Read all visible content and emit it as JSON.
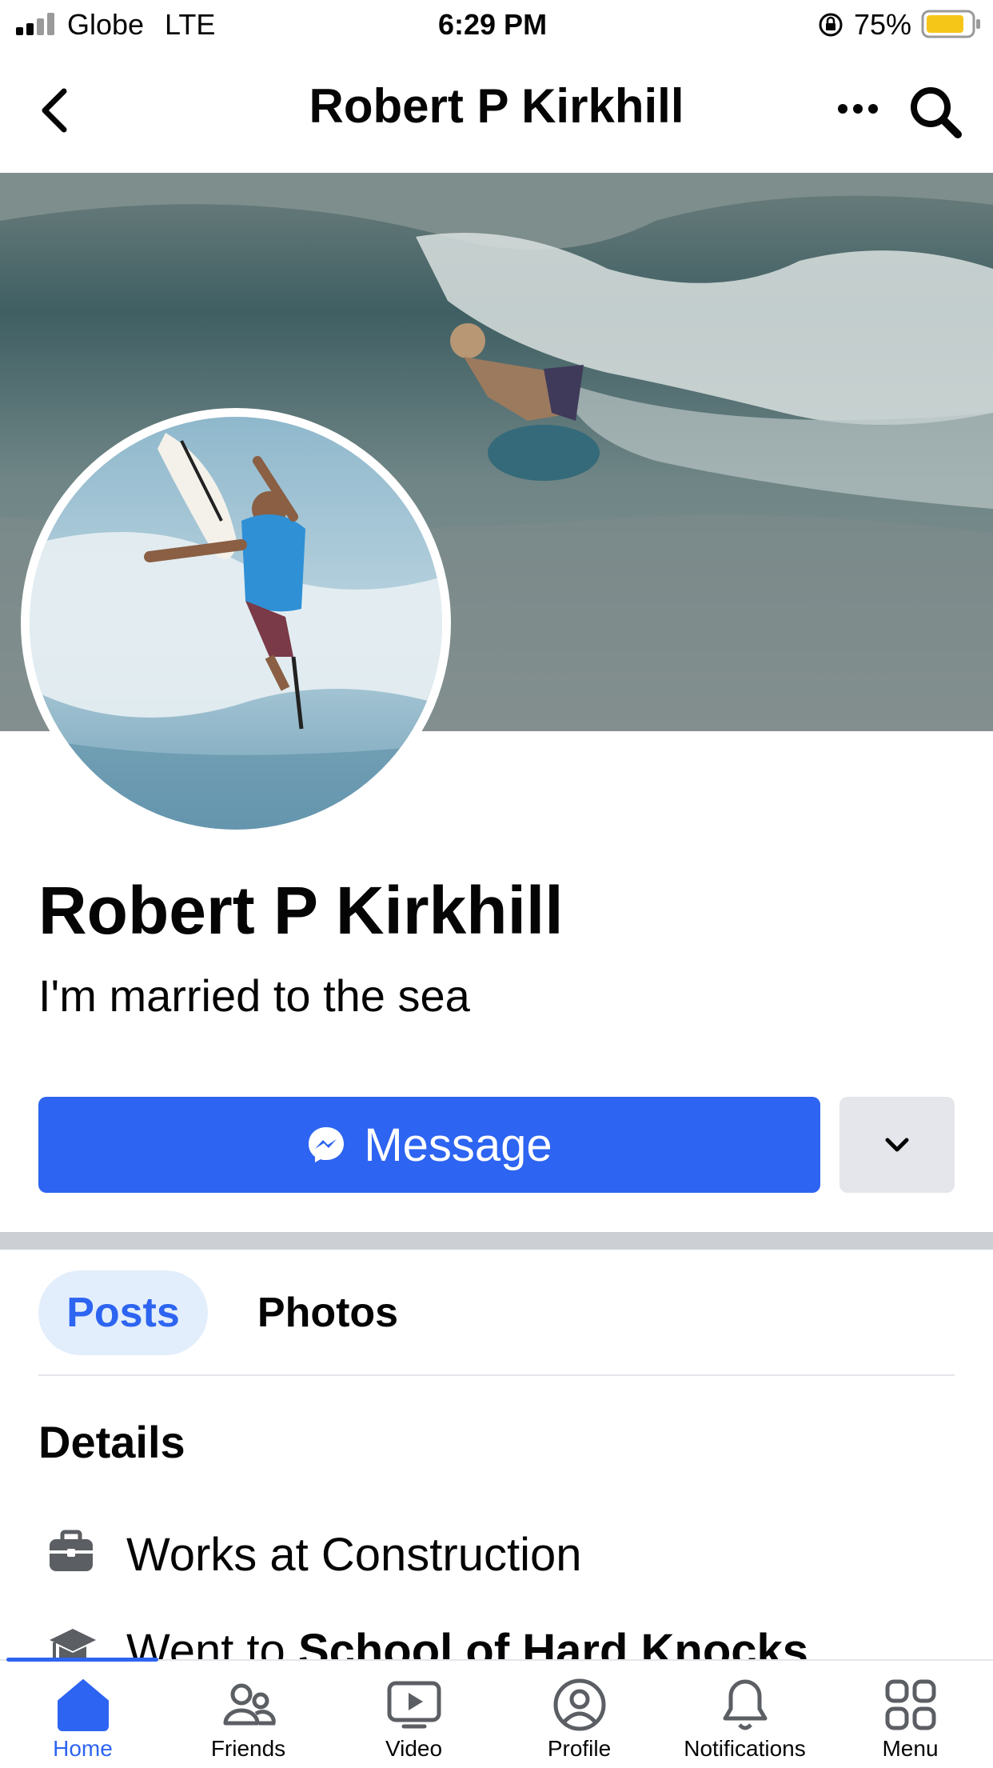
{
  "status_bar": {
    "carrier": "Globe",
    "network": "LTE",
    "time": "6:29 PM",
    "battery": "75%"
  },
  "header": {
    "title": "Robert P Kirkhill"
  },
  "profile": {
    "name": "Robert P Kirkhill",
    "bio": "I'm married to the sea",
    "message_label": "Message"
  },
  "tabs": [
    {
      "label": "Posts",
      "active": true
    },
    {
      "label": "Photos",
      "active": false
    }
  ],
  "details": {
    "heading": "Details",
    "items": [
      {
        "icon": "briefcase-icon",
        "prefix": "Works at ",
        "bold": "Construction"
      },
      {
        "icon": "graduation-cap-icon",
        "prefix": "Went to ",
        "bold": "School of Hard Knocks"
      }
    ]
  },
  "bottom_nav": [
    {
      "label": "Home",
      "icon": "home-icon",
      "active": true
    },
    {
      "label": "Friends",
      "icon": "friends-icon",
      "active": false
    },
    {
      "label": "Video",
      "icon": "video-icon",
      "active": false
    },
    {
      "label": "Profile",
      "icon": "profile-icon",
      "active": false
    },
    {
      "label": "Notifications",
      "icon": "bell-icon",
      "active": false
    },
    {
      "label": "Menu",
      "icon": "menu-grid-icon",
      "active": false
    }
  ],
  "colors": {
    "accent": "#2d64f1",
    "tab_active_bg": "#e3eefc",
    "secondary_btn": "#e4e6eb",
    "battery": "#f5c518"
  }
}
